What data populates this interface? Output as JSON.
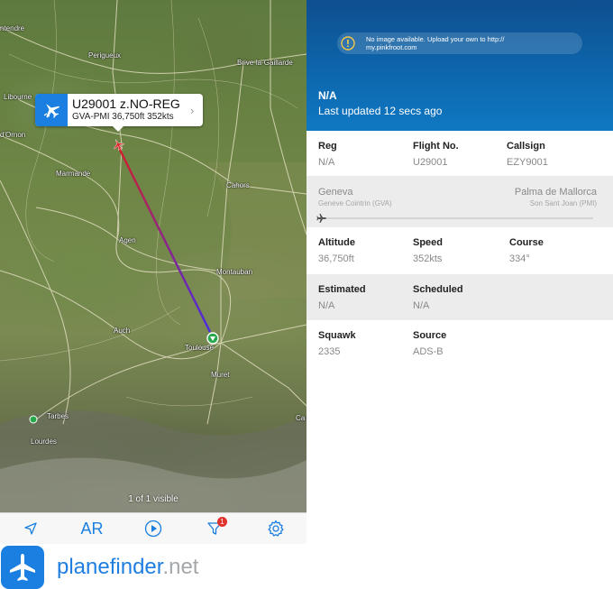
{
  "map": {
    "cities": [
      {
        "name": "ntendre"
      },
      {
        "name": "Perigueux"
      },
      {
        "name": "Brive-la-Gaillarde"
      },
      {
        "name": "Libourne"
      },
      {
        "name": "d'Ornon"
      },
      {
        "name": "Cahors"
      },
      {
        "name": "Marmande"
      },
      {
        "name": "Agen"
      },
      {
        "name": "Montauban"
      },
      {
        "name": "Auch"
      },
      {
        "name": "Toulouse"
      },
      {
        "name": "Muret"
      },
      {
        "name": "Tarbes"
      },
      {
        "name": "Lourdes"
      },
      {
        "name": "Ca"
      }
    ],
    "popup": {
      "title": "U29001 z.NO-REG",
      "subtitle": "GVA-PMI 36,750ft 352kts"
    },
    "visible_count": "1 of 1 visible",
    "track_colors": {
      "start": "#d3202a",
      "end": "#4b2be0"
    }
  },
  "toolbar": {
    "location_icon": "location-arrow-icon",
    "ar_label": "AR",
    "play_icon": "play-circle-icon",
    "filter_icon": "filter-icon",
    "filter_badge": "1",
    "settings_icon": "gear-icon"
  },
  "brand": {
    "name_main": "planefinder",
    "name_tld": ".net"
  },
  "details": {
    "no_image_text": "No image available. Upload your own to http://\nmy.pinkfroot.com",
    "title": "N/A",
    "last_updated": "Last updated 12 secs ago",
    "reg": {
      "label": "Reg",
      "value": "N/A"
    },
    "flight_no": {
      "label": "Flight No.",
      "value": "U29001"
    },
    "callsign": {
      "label": "Callsign",
      "value": "EZY9001"
    },
    "route": {
      "from_city": "Geneva",
      "from_airport": "Geneve Cointrin (GVA)",
      "to_city": "Palma de Mallorca",
      "to_airport": "Son Sant Joan (PMI)"
    },
    "altitude": {
      "label": "Altitude",
      "value": "36,750ft"
    },
    "speed": {
      "label": "Speed",
      "value": "352kts"
    },
    "course": {
      "label": "Course",
      "value": "334°"
    },
    "estimated": {
      "label": "Estimated",
      "value": "N/A"
    },
    "scheduled": {
      "label": "Scheduled",
      "value": "N/A"
    },
    "squawk": {
      "label": "Squawk",
      "value": "2335"
    },
    "source": {
      "label": "Source",
      "value": "ADS-B"
    }
  },
  "colors": {
    "accent": "#1a7fe0",
    "header_blue": "#0d66ac",
    "badge_red": "#e2322b"
  }
}
